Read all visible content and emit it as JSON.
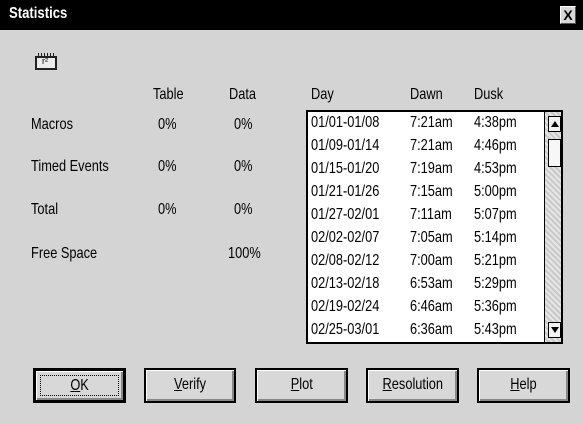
{
  "window": {
    "title": "Statistics",
    "close_label": "X"
  },
  "icon": {
    "name": "r-squared-icon"
  },
  "stats": {
    "headers": {
      "table": "Table",
      "data": "Data"
    },
    "rows": [
      {
        "label": "Macros",
        "table": "0%",
        "data": "0%"
      },
      {
        "label": "Timed Events",
        "table": "0%",
        "data": "0%"
      },
      {
        "label": "Total",
        "table": "0%",
        "data": "0%"
      },
      {
        "label": "Free Space",
        "table": "",
        "data": "100%"
      }
    ]
  },
  "list": {
    "headers": {
      "day": "Day",
      "dawn": "Dawn",
      "dusk": "Dusk"
    },
    "rows": [
      {
        "day": "01/01-01/08",
        "dawn": "7:21am",
        "dusk": "4:38pm"
      },
      {
        "day": "01/09-01/14",
        "dawn": "7:21am",
        "dusk": "4:46pm"
      },
      {
        "day": "01/15-01/20",
        "dawn": "7:19am",
        "dusk": "4:53pm"
      },
      {
        "day": "01/21-01/26",
        "dawn": "7:15am",
        "dusk": "5:00pm"
      },
      {
        "day": "01/27-02/01",
        "dawn": "7:11am",
        "dusk": "5:07pm"
      },
      {
        "day": "02/02-02/07",
        "dawn": "7:05am",
        "dusk": "5:14pm"
      },
      {
        "day": "02/08-02/12",
        "dawn": "7:00am",
        "dusk": "5:21pm"
      },
      {
        "day": "02/13-02/18",
        "dawn": "6:53am",
        "dusk": "5:29pm"
      },
      {
        "day": "02/19-02/24",
        "dawn": "6:46am",
        "dusk": "5:36pm"
      },
      {
        "day": "02/25-03/01",
        "dawn": "6:36am",
        "dusk": "5:43pm"
      }
    ]
  },
  "buttons": {
    "ok": {
      "mnemonic": "O",
      "rest": "K"
    },
    "verify": {
      "mnemonic": "V",
      "rest": "erify"
    },
    "plot": {
      "mnemonic": "P",
      "rest": "lot"
    },
    "resolution": {
      "mnemonic": "R",
      "rest": "esolution"
    },
    "help": {
      "mnemonic": "H",
      "rest": "elp"
    }
  }
}
